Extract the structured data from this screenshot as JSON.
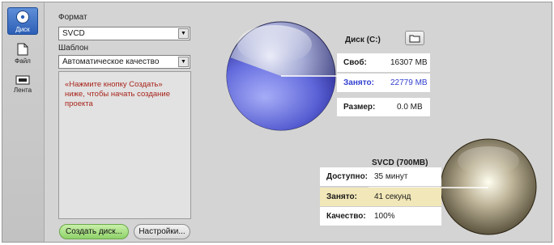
{
  "sidebar": {
    "items": [
      {
        "label": "Диск",
        "icon": "disc-icon",
        "active": true
      },
      {
        "label": "Файл",
        "icon": "file-icon",
        "active": false
      },
      {
        "label": "Лента",
        "icon": "tape-icon",
        "active": false
      }
    ]
  },
  "left_panel": {
    "format_label": "Формат",
    "format_value": "SVCD",
    "template_label": "Шаблон",
    "template_value": "Автоматическое качество",
    "message": "«Нажмите кнопку Создать» ниже, чтобы начать создание проекта",
    "create_button": "Создать диск...",
    "settings_button": "Настройки..."
  },
  "disk_info": {
    "title": "Диск (C:)",
    "rows": [
      {
        "label": "Своб:",
        "value": "16307 MB"
      },
      {
        "label": "Занято:",
        "value": "22779 MB"
      },
      {
        "label": "Размер:",
        "value": "0.0 MB"
      }
    ]
  },
  "media_info": {
    "title": "SVCD (700MB)",
    "rows": [
      {
        "label": "Доступно:",
        "value": "35 минут"
      },
      {
        "label": "Занято:",
        "value": "41 секунд"
      },
      {
        "label": "Качество:",
        "value": "100%"
      }
    ]
  },
  "colors": {
    "accent": "#2d5fb6",
    "used_disk": "#3340d0",
    "used_media_bg": "#f2e7b8",
    "message_text": "#a8251c"
  }
}
